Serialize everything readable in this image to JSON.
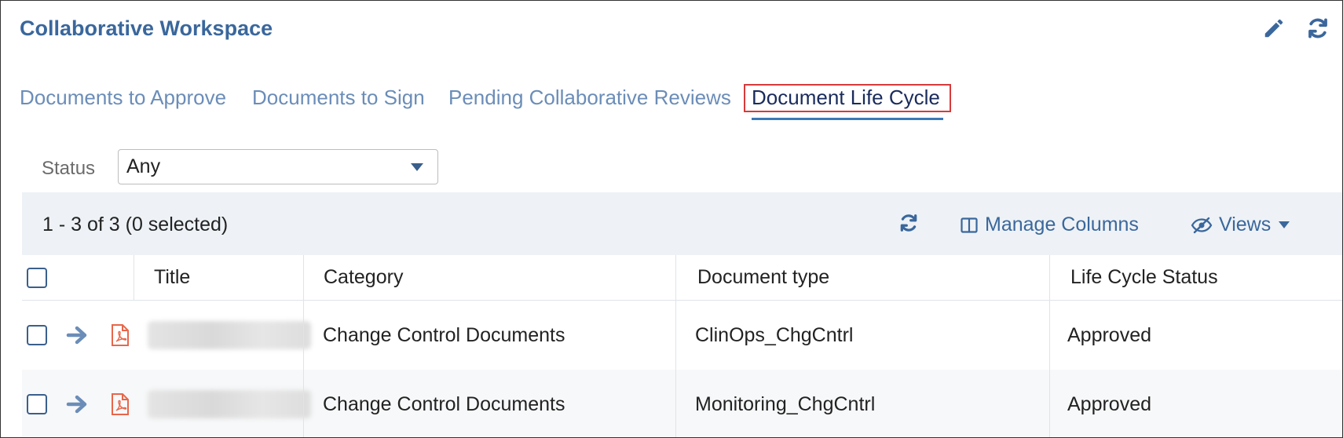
{
  "header": {
    "title": "Collaborative Workspace",
    "edit_icon": "pencil-icon",
    "refresh_icon": "refresh-icon"
  },
  "tabs": [
    {
      "label": "Documents to Approve",
      "active": false
    },
    {
      "label": "Documents to Sign",
      "active": false
    },
    {
      "label": "Pending Collaborative Reviews",
      "active": false
    },
    {
      "label": "Document Life Cycle",
      "active": true
    }
  ],
  "filter": {
    "label": "Status",
    "value": "Any"
  },
  "grid": {
    "count_text": "1 - 3 of 3 (0 selected)",
    "manage_columns_label": "Manage Columns",
    "views_label": "Views",
    "columns": [
      "Title",
      "Category",
      "Document type",
      "Life Cycle Status"
    ],
    "rows": [
      {
        "title": "",
        "category": "Change Control Documents",
        "document_type": "ClinOps_ChgCntrl",
        "status": "Approved"
      },
      {
        "title": "",
        "category": "Change Control Documents",
        "document_type": "Monitoring_ChgCntrl",
        "status": "Approved"
      }
    ]
  },
  "colors": {
    "accent": "#3a679c",
    "tab_inactive": "#6b8db8",
    "tab_active": "#1a2b5c",
    "highlight_box": "#d63a3a",
    "pdf_icon": "#e8664a",
    "toolbar_bg": "#eef2f6"
  }
}
